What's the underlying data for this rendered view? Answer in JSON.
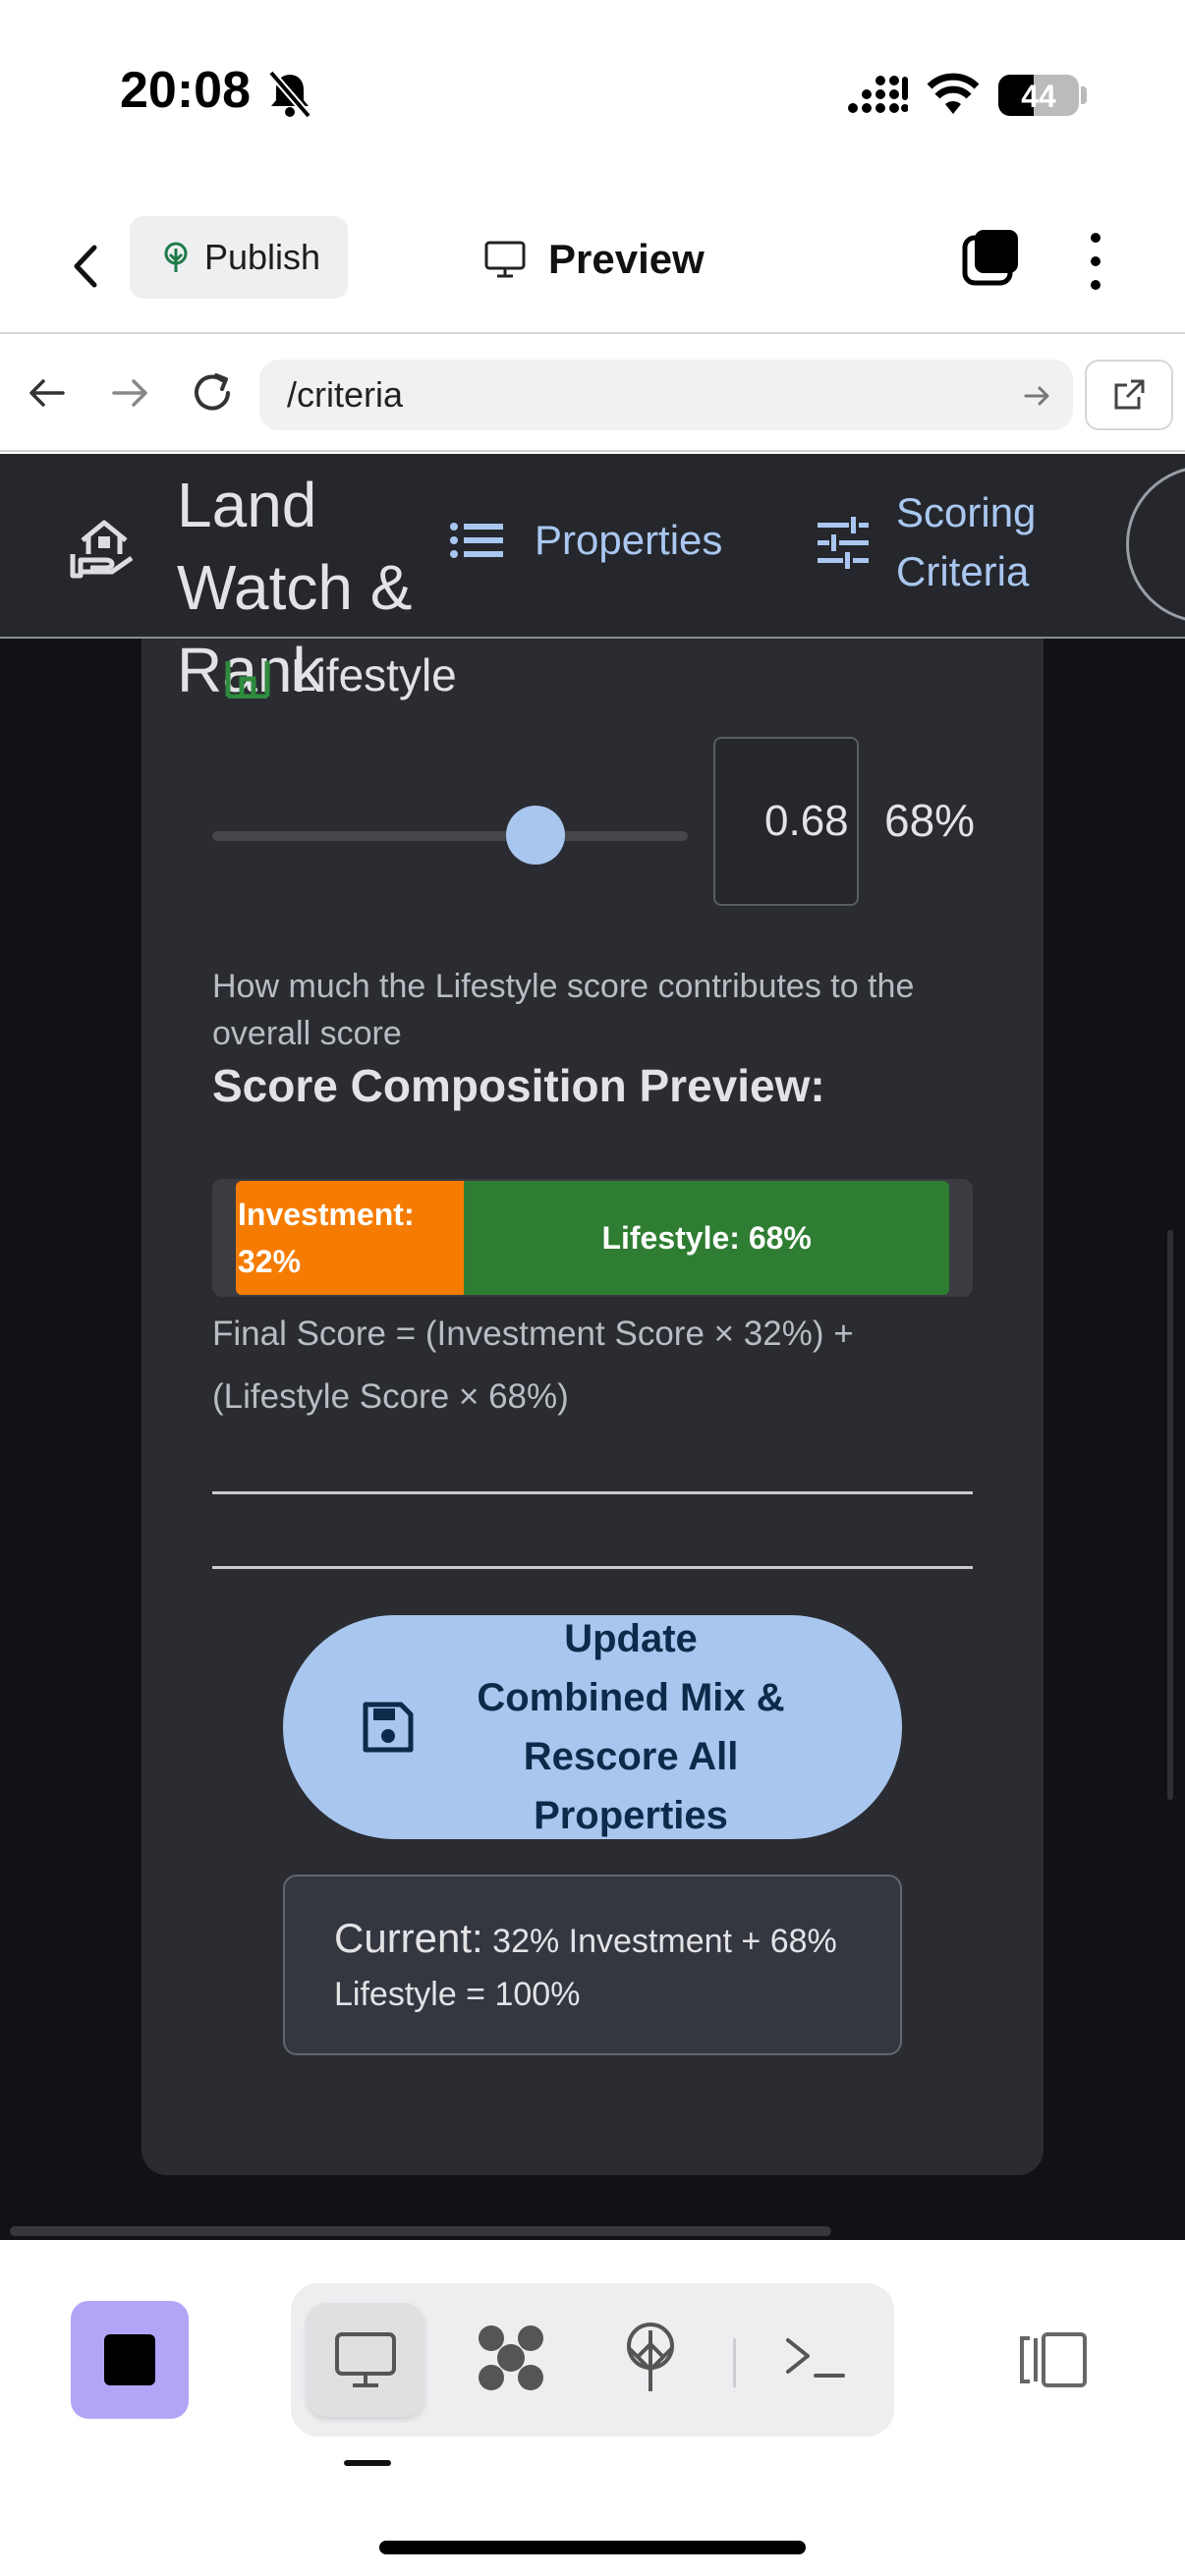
{
  "status_bar": {
    "time": "20:08",
    "battery": "44",
    "battery_level": 0.44
  },
  "app_header": {
    "publish_label": "Publish",
    "preview_label": "Preview"
  },
  "url_bar": {
    "url": "/criteria"
  },
  "site_nav": {
    "brand": "Land Watch & Rank",
    "properties_label": "Properties",
    "scoring_label": "Scoring Criteria"
  },
  "lifestyle": {
    "label": "Lifestyle",
    "weight_value": "0.68",
    "weight_fraction": 0.68,
    "percent_label": "68%",
    "help_text": "How much the Lifestyle score contributes to the overall score"
  },
  "composition": {
    "title": "Score Composition Preview:",
    "investment_label": "Investment: 32%",
    "investment_pct": 32,
    "lifestyle_label": "Lifestyle: 68%",
    "lifestyle_pct": 68,
    "formula": "Final Score = (Investment Score × 32%) + (Lifestyle Score × 68%)"
  },
  "update_button_label": "Update Combined Mix & Rescore All Properties",
  "current": {
    "head": "Current:",
    "text": "32% Investment + 68% Lifestyle = 100%"
  },
  "colors": {
    "investment": "#f57c00",
    "lifestyle": "#2e7d32",
    "accent": "#a8c6ee",
    "stop_button": "#b4a4f8"
  }
}
